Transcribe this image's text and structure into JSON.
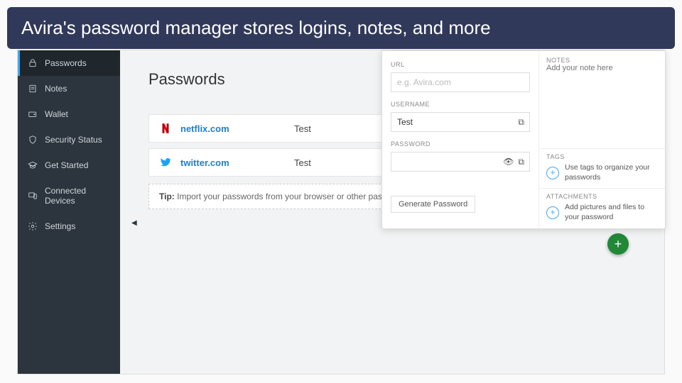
{
  "banner": "Avira's password manager stores logins, notes, and more",
  "sidebar": {
    "items": [
      {
        "label": "Passwords"
      },
      {
        "label": "Notes"
      },
      {
        "label": "Wallet"
      },
      {
        "label": "Security Status"
      },
      {
        "label": "Get Started"
      },
      {
        "label": "Connected Devices"
      },
      {
        "label": "Settings"
      }
    ]
  },
  "main": {
    "title": "Passwords",
    "rows": [
      {
        "domain": "netflix.com",
        "user": "Test"
      },
      {
        "domain": "twitter.com",
        "user": "Test"
      }
    ],
    "tip_label": "Tip:",
    "tip_text": " Import your passwords from your browser or other password"
  },
  "detail": {
    "url_label": "URL",
    "url_placeholder": "e.g. Avira.com",
    "url_value": "",
    "username_label": "USERNAME",
    "username_value": "Test",
    "password_label": "PASSWORD",
    "password_value": "",
    "generate_label": "Generate Password",
    "notes_label": "NOTES",
    "notes_placeholder": "Add your note here",
    "tags_label": "TAGS",
    "tags_hint": "Use tags to organize your passwords",
    "attachments_label": "ATTACHMENTS",
    "attachments_hint": "Add pictures and files to your password"
  }
}
